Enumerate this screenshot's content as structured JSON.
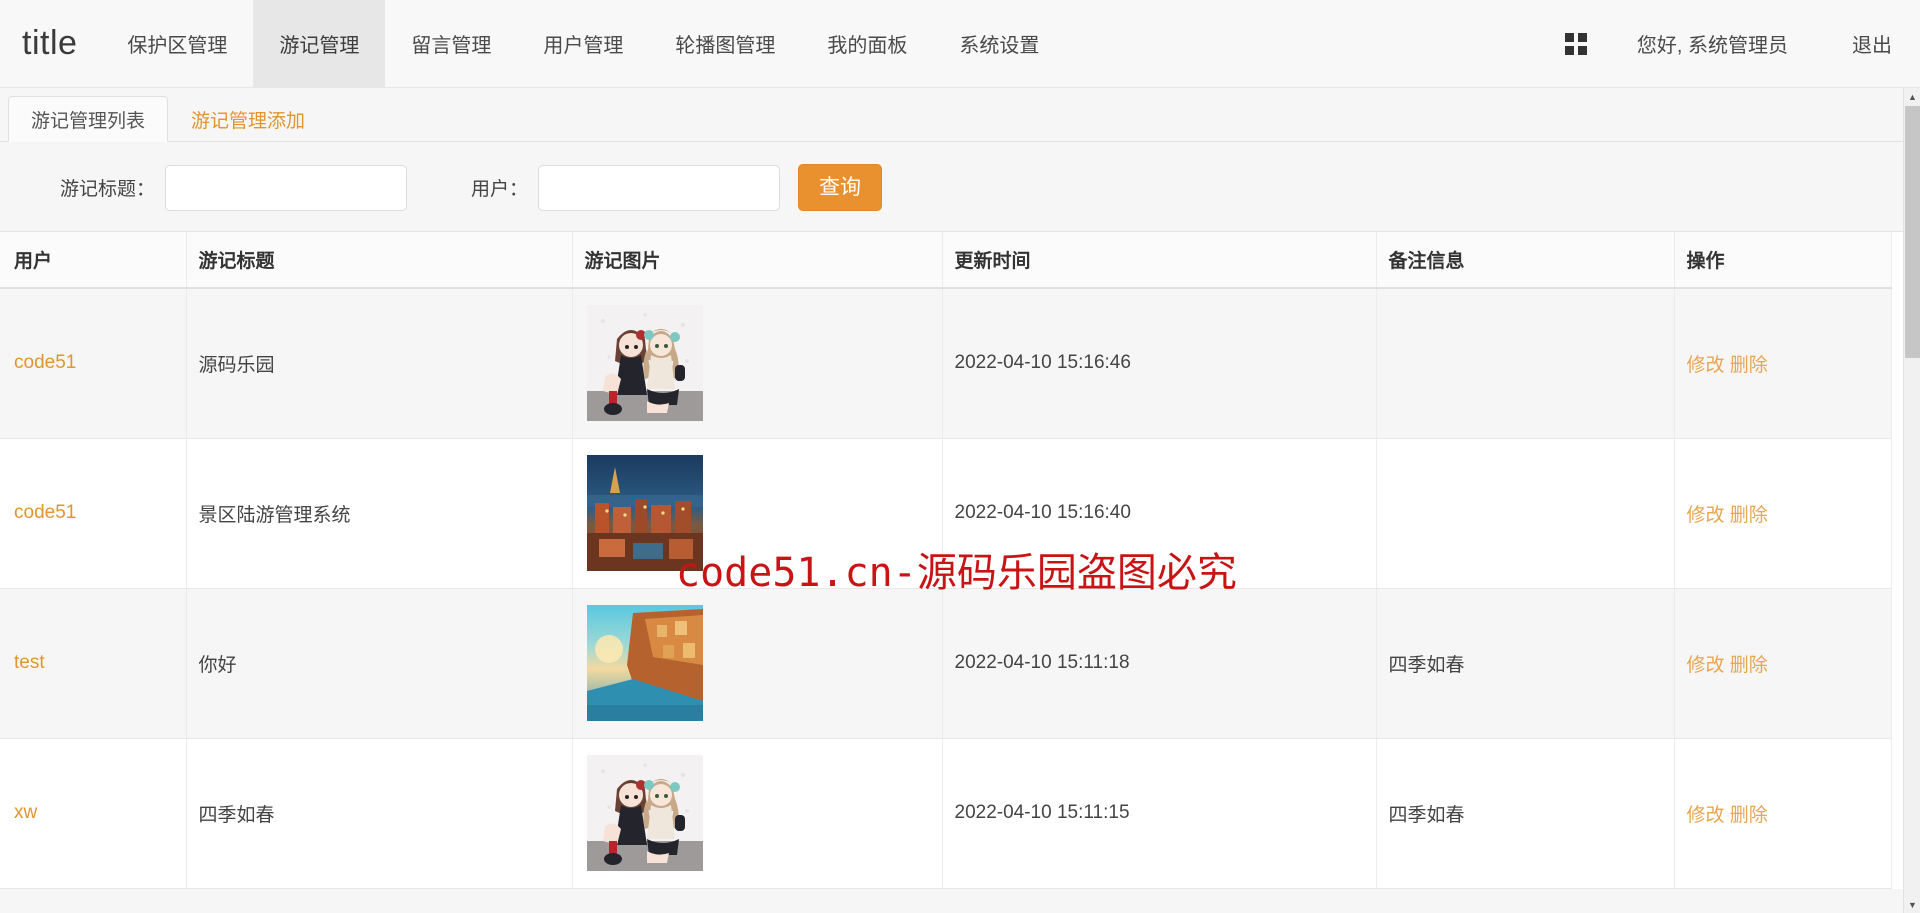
{
  "navbar": {
    "brand": "title",
    "items": [
      {
        "label": "保护区管理",
        "active": false
      },
      {
        "label": "游记管理",
        "active": true
      },
      {
        "label": "留言管理",
        "active": false
      },
      {
        "label": "用户管理",
        "active": false
      },
      {
        "label": "轮播图管理",
        "active": false
      },
      {
        "label": "我的面板",
        "active": false
      },
      {
        "label": "系统设置",
        "active": false
      }
    ],
    "grid_icon": "grid-2x2-icon",
    "greeting": "您好, 系统管理员",
    "logout": "退出"
  },
  "tabs": [
    {
      "label": "游记管理列表",
      "active": true
    },
    {
      "label": "游记管理添加",
      "active": false
    }
  ],
  "search": {
    "title_label": "游记标题：",
    "title_value": "",
    "title_placeholder": "",
    "user_label": "用户：",
    "user_value": "",
    "user_placeholder": "",
    "query_button": "查询"
  },
  "table": {
    "columns": [
      "用户",
      "游记标题",
      "游记图片",
      "更新时间",
      "备注信息",
      "操作"
    ],
    "rows": [
      {
        "user": "code51",
        "title": "源码乐园",
        "image": "anime-girls-thumbnail",
        "updated": "2022-04-10 15:16:46",
        "remark": "",
        "edit": "修改",
        "delete": "删除"
      },
      {
        "user": "code51",
        "title": "景区陆游管理系统",
        "image": "city-night-skyline-thumbnail",
        "updated": "2022-04-10 15:16:40",
        "remark": "",
        "edit": "修改",
        "delete": "删除"
      },
      {
        "user": "test",
        "title": "你好",
        "image": "coastal-cliff-sunset-thumbnail",
        "updated": "2022-04-10 15:11:18",
        "remark": "四季如春",
        "edit": "修改",
        "delete": "删除"
      },
      {
        "user": "xw",
        "title": "四季如春",
        "image": "anime-girls-thumbnail",
        "updated": "2022-04-10 15:11:15",
        "remark": "四季如春",
        "edit": "修改",
        "delete": "删除"
      }
    ]
  },
  "watermark": {
    "text": "code51.cn-源码乐园盗图必究"
  },
  "scrollbar": {
    "up_arrow": "▲",
    "down_arrow": "▼"
  },
  "colors": {
    "accent_orange": "#e8912e",
    "link_orange": "#e0952f",
    "watermark_red": "#c81414",
    "nav_active_bg": "#e7e7e7"
  }
}
